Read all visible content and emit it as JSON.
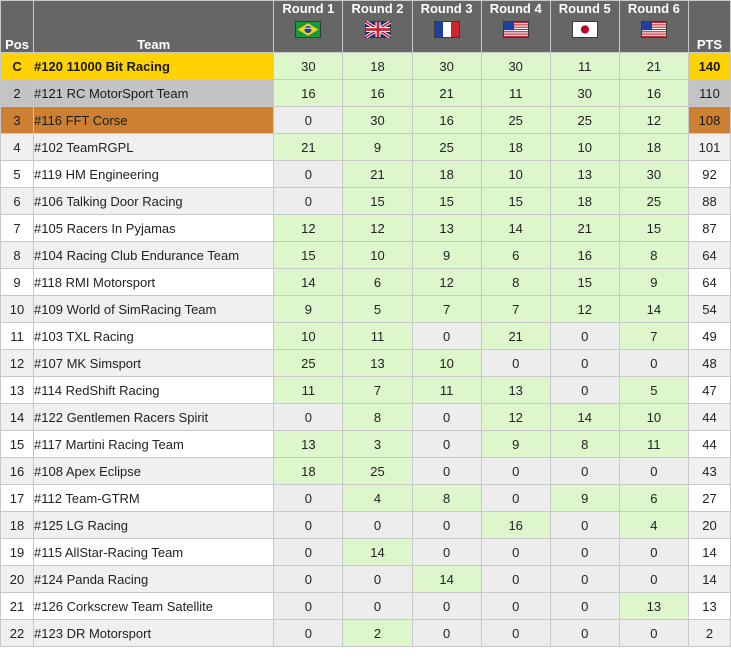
{
  "table": {
    "columns": {
      "pos": "Pos",
      "team": "Team",
      "pts": "PTS",
      "rounds": [
        {
          "label": "Round 1",
          "flag": "flag-brazil-icon",
          "country": "Brazil"
        },
        {
          "label": "Round 2",
          "flag": "flag-united-kingdom-icon",
          "country": "United Kingdom"
        },
        {
          "label": "Round 3",
          "flag": "flag-france-icon",
          "country": "France"
        },
        {
          "label": "Round 4",
          "flag": "flag-united-states-icon",
          "country": "United States"
        },
        {
          "label": "Round 5",
          "flag": "flag-japan-icon",
          "country": "Japan"
        },
        {
          "label": "Round 6",
          "flag": "flag-united-states-icon",
          "country": "United States"
        }
      ]
    },
    "colors": {
      "header_background": "#666666",
      "gold": "#ffd200",
      "silver": "#c3c3c3",
      "bronze": "#cd7f32",
      "score_scored": "#ddf6cb",
      "score_zero": "#ededed",
      "row_alt": "#f0f0f0"
    },
    "rows": [
      {
        "pos": "C",
        "team": "#120 11000 Bit Racing",
        "scores": [
          30,
          18,
          30,
          30,
          11,
          21
        ],
        "pts": 140,
        "medal": "gold"
      },
      {
        "pos": "2",
        "team": "#121 RC MotorSport Team",
        "scores": [
          16,
          16,
          21,
          11,
          30,
          16
        ],
        "pts": 110,
        "medal": "silver"
      },
      {
        "pos": "3",
        "team": "#116 FFT Corse",
        "scores": [
          0,
          30,
          16,
          25,
          25,
          12
        ],
        "pts": 108,
        "medal": "bronze"
      },
      {
        "pos": "4",
        "team": "#102 TeamRGPL",
        "scores": [
          21,
          9,
          25,
          18,
          10,
          18
        ],
        "pts": 101,
        "medal": ""
      },
      {
        "pos": "5",
        "team": "#119 HM Engineering",
        "scores": [
          0,
          21,
          18,
          10,
          13,
          30
        ],
        "pts": 92,
        "medal": ""
      },
      {
        "pos": "6",
        "team": "#106 Talking Door Racing",
        "scores": [
          0,
          15,
          15,
          15,
          18,
          25
        ],
        "pts": 88,
        "medal": ""
      },
      {
        "pos": "7",
        "team": "#105 Racers In Pyjamas",
        "scores": [
          12,
          12,
          13,
          14,
          21,
          15
        ],
        "pts": 87,
        "medal": ""
      },
      {
        "pos": "8",
        "team": "#104 Racing Club Endurance Team",
        "scores": [
          15,
          10,
          9,
          6,
          16,
          8
        ],
        "pts": 64,
        "medal": ""
      },
      {
        "pos": "9",
        "team": "#118 RMI Motorsport",
        "scores": [
          14,
          6,
          12,
          8,
          15,
          9
        ],
        "pts": 64,
        "medal": ""
      },
      {
        "pos": "10",
        "team": "#109 World of SimRacing Team",
        "scores": [
          9,
          5,
          7,
          7,
          12,
          14
        ],
        "pts": 54,
        "medal": ""
      },
      {
        "pos": "11",
        "team": "#103 TXL Racing",
        "scores": [
          10,
          11,
          0,
          21,
          0,
          7
        ],
        "pts": 49,
        "medal": ""
      },
      {
        "pos": "12",
        "team": "#107 MK Simsport",
        "scores": [
          25,
          13,
          10,
          0,
          0,
          0
        ],
        "pts": 48,
        "medal": ""
      },
      {
        "pos": "13",
        "team": "#114 RedShift Racing",
        "scores": [
          11,
          7,
          11,
          13,
          0,
          5
        ],
        "pts": 47,
        "medal": ""
      },
      {
        "pos": "14",
        "team": "#122 Gentlemen Racers Spirit",
        "scores": [
          0,
          8,
          0,
          12,
          14,
          10
        ],
        "pts": 44,
        "medal": ""
      },
      {
        "pos": "15",
        "team": "#117 Martini Racing Team",
        "scores": [
          13,
          3,
          0,
          9,
          8,
          11
        ],
        "pts": 44,
        "medal": ""
      },
      {
        "pos": "16",
        "team": "#108 Apex Eclipse",
        "scores": [
          18,
          25,
          0,
          0,
          0,
          0
        ],
        "pts": 43,
        "medal": ""
      },
      {
        "pos": "17",
        "team": "#112 Team-GTRM",
        "scores": [
          0,
          4,
          8,
          0,
          9,
          6
        ],
        "pts": 27,
        "medal": ""
      },
      {
        "pos": "18",
        "team": "#125 LG Racing",
        "scores": [
          0,
          0,
          0,
          16,
          0,
          4
        ],
        "pts": 20,
        "medal": ""
      },
      {
        "pos": "19",
        "team": "#115 AllStar-Racing Team",
        "scores": [
          0,
          14,
          0,
          0,
          0,
          0
        ],
        "pts": 14,
        "medal": ""
      },
      {
        "pos": "20",
        "team": "#124 Panda Racing",
        "scores": [
          0,
          0,
          14,
          0,
          0,
          0
        ],
        "pts": 14,
        "medal": ""
      },
      {
        "pos": "21",
        "team": "#126 Corkscrew Team Satellite",
        "scores": [
          0,
          0,
          0,
          0,
          0,
          13
        ],
        "pts": 13,
        "medal": ""
      },
      {
        "pos": "22",
        "team": "#123 DR Motorsport",
        "scores": [
          0,
          2,
          0,
          0,
          0,
          0
        ],
        "pts": 2,
        "medal": ""
      }
    ]
  }
}
